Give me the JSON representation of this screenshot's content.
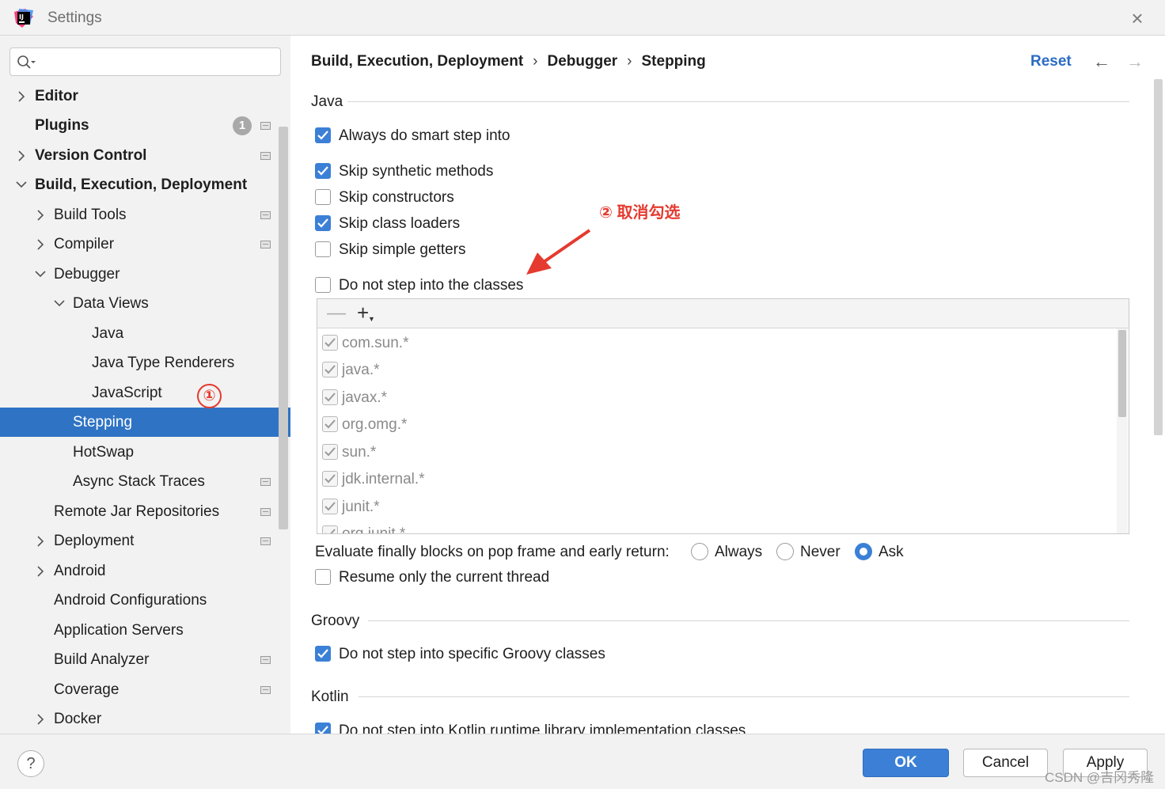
{
  "window": {
    "title": "Settings"
  },
  "sidebar": {
    "search_placeholder": "",
    "items": [
      {
        "label": "Editor",
        "bold": true
      },
      {
        "label": "Plugins",
        "bold": true,
        "badge": "1"
      },
      {
        "label": "Version Control",
        "bold": true
      },
      {
        "label": "Build, Execution, Deployment",
        "bold": true
      },
      {
        "label": "Build Tools"
      },
      {
        "label": "Compiler"
      },
      {
        "label": "Debugger"
      },
      {
        "label": "Data Views"
      },
      {
        "label": "Java"
      },
      {
        "label": "Java Type Renderers"
      },
      {
        "label": "JavaScript"
      },
      {
        "label": "Stepping",
        "selected": true
      },
      {
        "label": "HotSwap"
      },
      {
        "label": "Async Stack Traces"
      },
      {
        "label": "Remote Jar Repositories"
      },
      {
        "label": "Deployment"
      },
      {
        "label": "Android"
      },
      {
        "label": "Android Configurations"
      },
      {
        "label": "Application Servers"
      },
      {
        "label": "Build Analyzer"
      },
      {
        "label": "Coverage"
      },
      {
        "label": "Docker"
      }
    ]
  },
  "breadcrumb": [
    "Build, Execution, Deployment",
    "Debugger",
    "Stepping"
  ],
  "header": {
    "reset_label": "Reset"
  },
  "java": {
    "title": "Java",
    "always_smart_step": {
      "label": "Always do smart step into",
      "checked": true
    },
    "skip_synthetic": {
      "label": "Skip synthetic methods",
      "checked": true
    },
    "skip_constructors": {
      "label": "Skip constructors",
      "checked": false
    },
    "skip_class_loaders": {
      "label": "Skip class loaders",
      "checked": true
    },
    "skip_simple_getters": {
      "label": "Skip simple getters",
      "checked": false
    },
    "do_not_step_classes": {
      "label": "Do not step into the classes",
      "checked": false
    },
    "class_filters": [
      "com.sun.*",
      "java.*",
      "javax.*",
      "org.omg.*",
      "sun.*",
      "jdk.internal.*",
      "junit.*",
      "org.junit.*"
    ],
    "evaluate_finally": {
      "label": "Evaluate finally blocks on pop frame and early return:",
      "options": [
        "Always",
        "Never",
        "Ask"
      ],
      "selected": "Ask"
    },
    "resume_current_thread": {
      "label": "Resume only the current thread",
      "checked": false
    }
  },
  "groovy": {
    "title": "Groovy",
    "do_not_step_groovy": {
      "label": "Do not step into specific Groovy classes",
      "checked": true
    }
  },
  "kotlin": {
    "title": "Kotlin",
    "do_not_step_kotlin": {
      "label": "Do not step into Kotlin runtime library implementation classes",
      "checked": true
    }
  },
  "annotations": {
    "marker_1": "①",
    "marker_2": "② 取消勾选",
    "color": "#e53a2f"
  },
  "footer": {
    "help_label": "?",
    "ok_label": "OK",
    "cancel_label": "Cancel",
    "apply_label": "Apply",
    "watermark": "CSDN @吉冈秀隆"
  },
  "colors": {
    "accent": "#3b80d6",
    "selection": "#2f73c4",
    "link": "#2b6bc4"
  }
}
